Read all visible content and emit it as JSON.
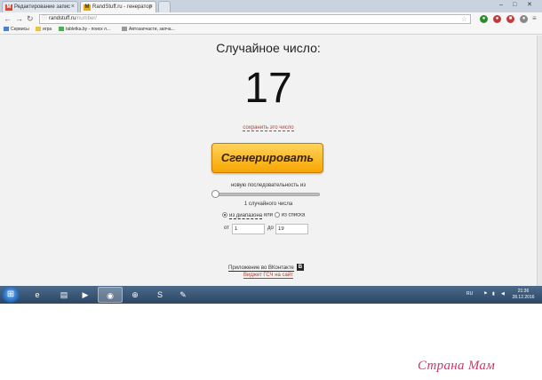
{
  "browser": {
    "tabs": [
      {
        "label": "Редактирование запис",
        "favicon": "M",
        "favicon_color": "#e0452b",
        "active": false
      },
      {
        "label": "RandStuff.ru - генератор",
        "favicon": "M",
        "favicon_color": "#f2a900",
        "active": true
      }
    ],
    "url_host": "randstuff.ru",
    "url_path": "/number/",
    "bookmarks": [
      "Сервисы",
      "игра",
      "tabletka.by - поиск л...",
      "Автозапчасти, запча..."
    ]
  },
  "page": {
    "heading": "Случайное число:",
    "result": "17",
    "save_link": "сохранить это число",
    "generate_label": "Сгенерировать",
    "sequence_label": "новую последовательность из",
    "count_text": "1 случайного числа",
    "mode_range": "из диапазона",
    "mode_or": "или",
    "mode_list": "из списка",
    "selected_mode": "из диапазона",
    "from_label": "от",
    "from_value": "1",
    "to_label": "до",
    "to_value": "19",
    "sequence_slider_value": 1,
    "vk_link": "Приложение во ВКонтакте",
    "vk_badge": "B",
    "widget_link": "Виджет ГСЧ на сайт"
  },
  "taskbar": {
    "language": "RU",
    "time": "21:36",
    "date": "28.12.2016"
  },
  "watermark": "Страна Мам",
  "colors": {
    "accent_button": "#f7a600",
    "link": "#a5463c",
    "taskbar": "#2b4664"
  }
}
